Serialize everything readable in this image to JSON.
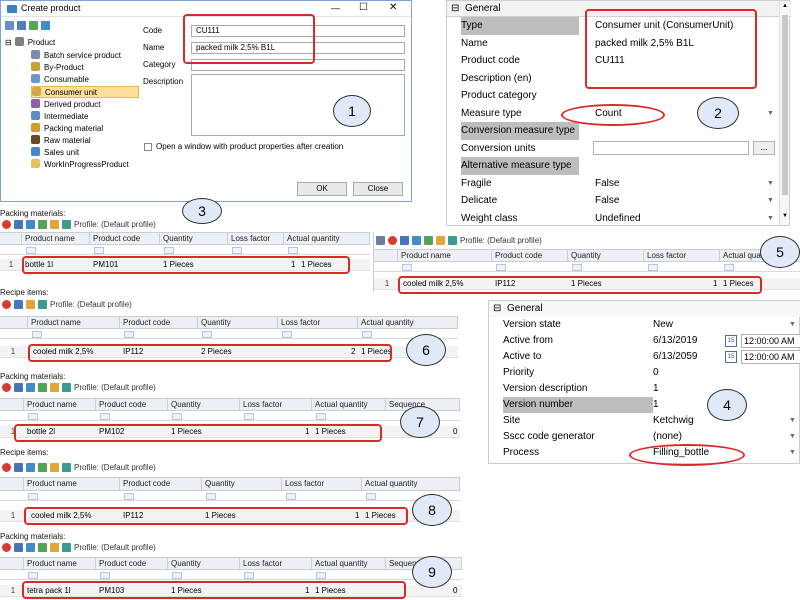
{
  "create_dialog": {
    "title": "Create product",
    "tree": [
      "Product",
      "Batch service product",
      "By-Product",
      "Consumable",
      "Consumer unit",
      "Derived product",
      "Intermediate",
      "Packing material",
      "Raw material",
      "Sales unit",
      "WorkInProgressProduct"
    ],
    "code_label": "Code",
    "code_value": "CU111",
    "name_label": "Name",
    "name_value": "packed milk 2,5% B1L",
    "category_label": "Category",
    "description_label": "Description",
    "checkbox_label": "Open a window with product properties after creation",
    "ok": "OK",
    "close": "Close",
    "window_controls": [
      "—",
      "☐",
      "✕"
    ]
  },
  "general_panel": {
    "header": "General",
    "rows": [
      {
        "k": "Type",
        "v": "Consumer unit (ConsumerUnit)",
        "hl": true
      },
      {
        "k": "Name",
        "v": "packed milk 2,5% B1L"
      },
      {
        "k": "Product code",
        "v": "CU111"
      },
      {
        "k": "Description (en)",
        "v": ""
      },
      {
        "k": "Product category",
        "v": ""
      },
      {
        "k": "Measure type",
        "v": "Count"
      },
      {
        "k": "Conversion measure type",
        "v": "",
        "hl": true
      },
      {
        "k": "Conversion units",
        "v": ""
      },
      {
        "k": "Alternative measure type",
        "v": "",
        "hl": true
      },
      {
        "k": "Fragile",
        "v": "False"
      },
      {
        "k": "Delicate",
        "v": "False"
      },
      {
        "k": "Weight class",
        "v": "Undefined"
      }
    ],
    "ellipsis": "..."
  },
  "version_panel": {
    "header": "General",
    "rows": [
      {
        "k": "Version state",
        "v": "New"
      },
      {
        "k": "Active from",
        "v": "6/13/2019",
        "t": "12:00:00 AM"
      },
      {
        "k": "Active to",
        "v": "6/13/2059",
        "t": "12:00:00 AM"
      },
      {
        "k": "Priority",
        "v": "0"
      },
      {
        "k": "Version description",
        "v": "1"
      },
      {
        "k": "Version number",
        "v": "1",
        "hl": true
      },
      {
        "k": "Site",
        "v": "Ketchwig"
      },
      {
        "k": "Sscc code generator",
        "v": "(none)"
      },
      {
        "k": "Process",
        "v": "Filling_bottle"
      }
    ],
    "calendar_label": "15"
  },
  "profile": "Profile: (Default profile)",
  "grids": {
    "g3": {
      "label": "Packing materials:",
      "cols": [
        "Product name",
        "Product code",
        "Quantity",
        "Loss factor",
        "Actual quantity"
      ],
      "row": [
        "bottle 1l",
        "PM101",
        "1 Pieces",
        "1",
        "1 Pieces"
      ]
    },
    "g5": {
      "cols": [
        "Product name",
        "Product code",
        "Quantity",
        "Loss factor",
        "Actual qua"
      ],
      "row": [
        "cooled milk 2,5%",
        "IP112",
        "1 Pieces",
        "1",
        "1 Pieces"
      ]
    },
    "g6": {
      "label": "Recipe items:",
      "cols": [
        "Product name",
        "Product code",
        "Quantity",
        "Loss factor",
        "Actual quantity"
      ],
      "row": [
        "cooled milk 2,5%",
        "IP112",
        "2 Pieces",
        "2",
        "1 Pieces"
      ]
    },
    "g7": {
      "label": "Packing materials:",
      "cols": [
        "Product name",
        "Product code",
        "Quantity",
        "Loss factor",
        "Actual quantity",
        "Sequence"
      ],
      "row": [
        "bottle 2l",
        "PM102",
        "1 Pieces",
        "1",
        "1 Pieces",
        "0"
      ]
    },
    "g8": {
      "label": "Recipe items:",
      "cols": [
        "Product name",
        "Product code",
        "Quantity",
        "Loss factor",
        "Actual quantity"
      ],
      "row": [
        "cooled milk 2,5%",
        "IP112",
        "1 Pieces",
        "1",
        "1 Pieces"
      ]
    },
    "g9": {
      "label": "Packing materials:",
      "cols": [
        "Product name",
        "Product code",
        "Quantity",
        "Loss factor",
        "Actual quantity",
        "Sequenc"
      ],
      "row": [
        "tetra pack 1l",
        "PM103",
        "1 Pieces",
        "1",
        "1 Pieces",
        "0"
      ]
    }
  },
  "row_number": "1",
  "filter_glyph": "A",
  "callouts": [
    "1",
    "2",
    "3",
    "4",
    "5",
    "6",
    "7",
    "8",
    "9"
  ]
}
